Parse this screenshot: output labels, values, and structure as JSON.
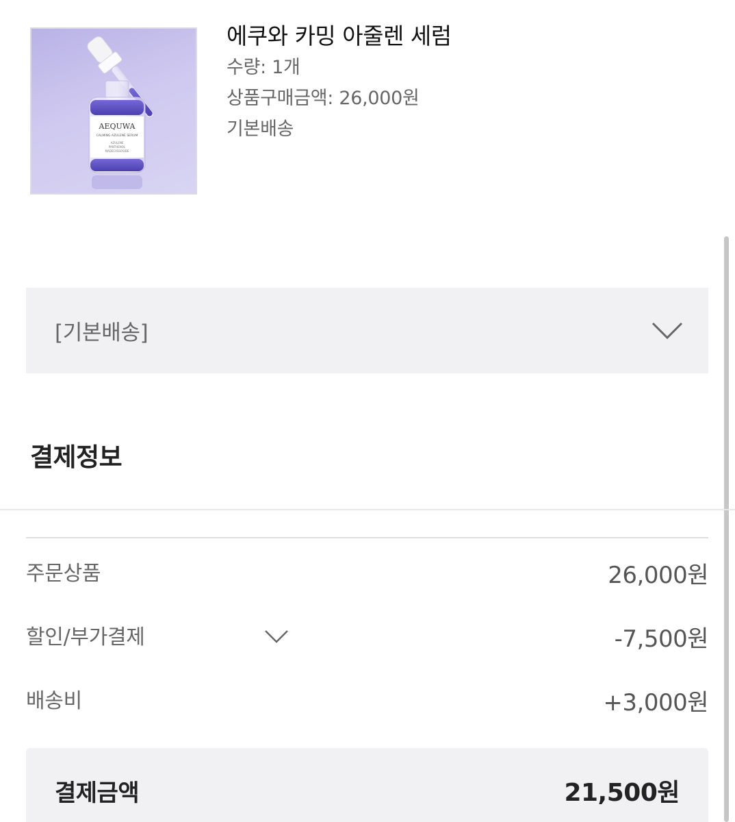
{
  "product": {
    "name": "에쿠와 카밍 아줄렌 세럼",
    "quantity": "수량: 1개",
    "price": "상품구매금액: 26,000원",
    "shipping_type": "기본배송",
    "image": {
      "brand": "AEQUWA",
      "subtitle": "CALMING AZULENE SERUM",
      "ingredients": [
        "AZULENE",
        "PANTHENOL",
        "MADECASSOSIDE"
      ]
    }
  },
  "shipping_select": {
    "label": "[기본배송]",
    "icon": "chevron-down-icon"
  },
  "payment_info": {
    "title": "결제정보",
    "rows": [
      {
        "label": "주문상품",
        "value": "26,000원"
      },
      {
        "label": "할인/부가결제",
        "value": "-7,500원",
        "icon": "chevron-down-icon"
      },
      {
        "label": "배송비",
        "value": "+3,000원"
      }
    ],
    "total": {
      "label": "결제금액",
      "value": "21,500원"
    }
  },
  "colors": {
    "panel_bg": "#f1f1f4",
    "serum_purple": "#5b4fbf",
    "label_gray": "#666666"
  }
}
